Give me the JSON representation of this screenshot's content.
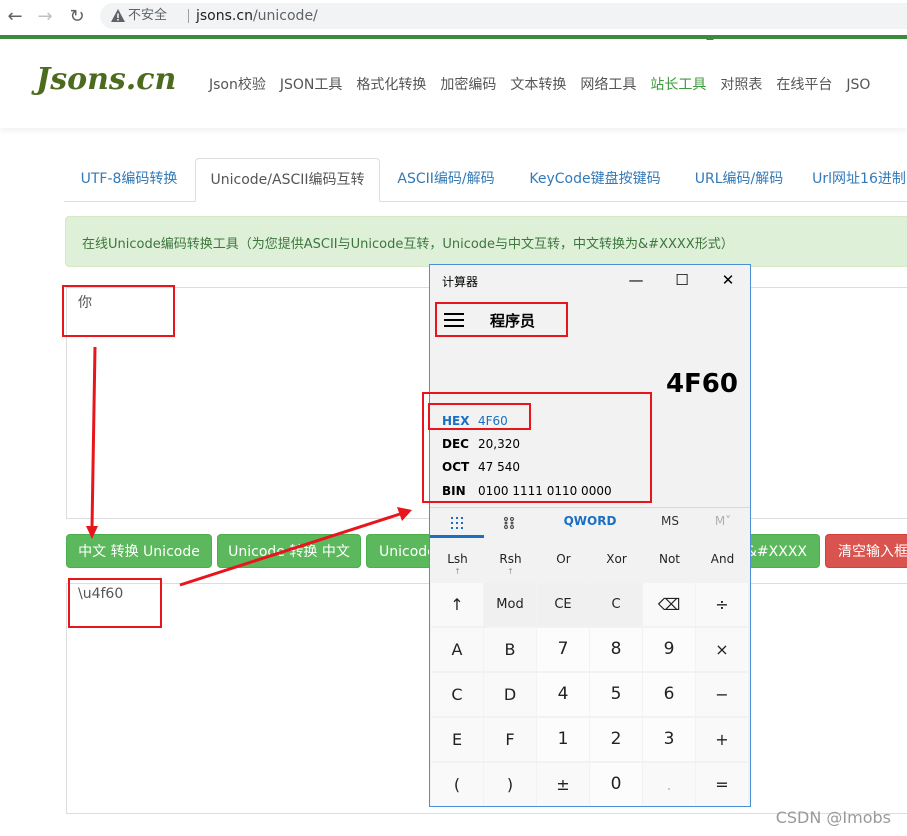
{
  "browser": {
    "back_icon": "arrow-left-icon",
    "forward_icon": "arrow-right-icon",
    "reload_icon": "reload-icon",
    "warning_icon": "warning-icon",
    "insecure_label": "不安全",
    "url_host": "jsons.cn",
    "url_path": "/unicode/"
  },
  "header": {
    "logo": "Jsons.cn",
    "nav": [
      "Json校验",
      "JSON工具",
      "格式化转换",
      "加密编码",
      "文本转换",
      "网络工具",
      "站长工具",
      "对照表",
      "在线平台",
      "JSO"
    ],
    "active_nav": "站长工具"
  },
  "tabs": [
    "UTF-8编码转换",
    "Unicode/ASCII编码互转",
    "ASCII编码/解码",
    "KeyCode键盘按键码",
    "URL编码/解码",
    "Url网址16进制"
  ],
  "active_tab": "Unicode/ASCII编码互转",
  "info": "在线Unicode编码转换工具（为您提供ASCII与Unicode互转，Unicode与中文互转，中文转换为&#XXXX形式）",
  "input_text": "你",
  "output_text": "\\u4f60",
  "buttons": {
    "cn_to_unicode": "中文 转换 Unicode",
    "unicode_to_cn": "Unicode 转换 中文",
    "unicode_partial": "Unicode",
    "to_xxxx": "&#XXXX",
    "clear": "清空输入框"
  },
  "calculator": {
    "title": "计算器",
    "minimize": "—",
    "maximize": "☐",
    "close": "✕",
    "mode": "程序员",
    "display": "4F60",
    "bases": [
      {
        "label": "HEX",
        "value": "4F60"
      },
      {
        "label": "DEC",
        "value": "20,320"
      },
      {
        "label": "OCT",
        "value": "47 540"
      },
      {
        "label": "BIN",
        "value": "0100 1111 0110 0000"
      }
    ],
    "tabs": {
      "keypad_icon": "keypad-icon",
      "bits_icon": "bit-toggle-icon",
      "word": "QWORD",
      "ms": "MS",
      "mplus": "M˅"
    },
    "bitops": [
      "Lsh",
      "Rsh",
      "Or",
      "Xor",
      "Not",
      "And"
    ],
    "bitop_arrow": "↑",
    "keys": [
      [
        "↑",
        "Mod",
        "CE",
        "C",
        "⌫",
        "÷"
      ],
      [
        "A",
        "B",
        "7",
        "8",
        "9",
        "×"
      ],
      [
        "C",
        "D",
        "4",
        "5",
        "6",
        "−"
      ],
      [
        "E",
        "F",
        "1",
        "2",
        "3",
        "+"
      ],
      [
        "(",
        ")",
        "±",
        "0",
        ".",
        "="
      ]
    ]
  },
  "watermark": "CSDN @Imobs",
  "colors": {
    "accent_green": "#5cb85c",
    "annotation_red": "#e8161c",
    "calc_blue": "#1a6fc2"
  }
}
